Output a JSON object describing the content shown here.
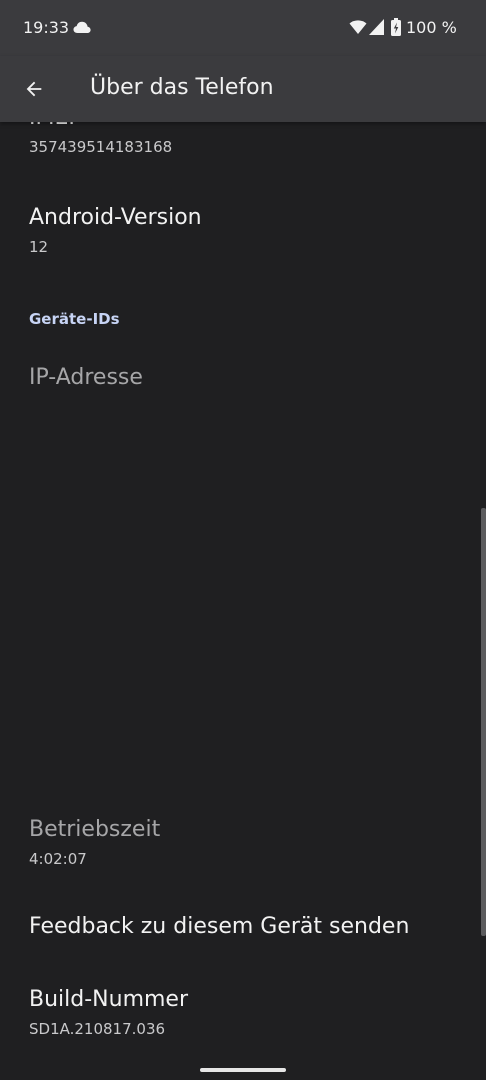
{
  "status_bar": {
    "time": "19:33",
    "battery": "100 %",
    "icons": [
      "cloud-icon",
      "wifi-icon",
      "signal-icon",
      "battery-icon"
    ]
  },
  "toolbar": {
    "back_icon": "arrow-left-icon",
    "title": "Über das Telefon"
  },
  "items": {
    "imei": {
      "title": "IMEI",
      "summary": "357439514183168"
    },
    "android_version": {
      "title": "Android-Version",
      "summary": "12"
    },
    "category": "Geräte-IDs",
    "ip_address": {
      "title": "IP-Adresse"
    },
    "uptime": {
      "title": "Betriebszeit",
      "summary": "4:02:07"
    },
    "feedback": {
      "title": "Feedback zu diesem Gerät senden"
    },
    "build_number": {
      "title": "Build-Nummer",
      "summary": "SD1A.210817.036"
    }
  },
  "colors": {
    "background": "#1f1f21",
    "toolbar": "#3b3b3e",
    "accent": "#c7d4f5"
  }
}
